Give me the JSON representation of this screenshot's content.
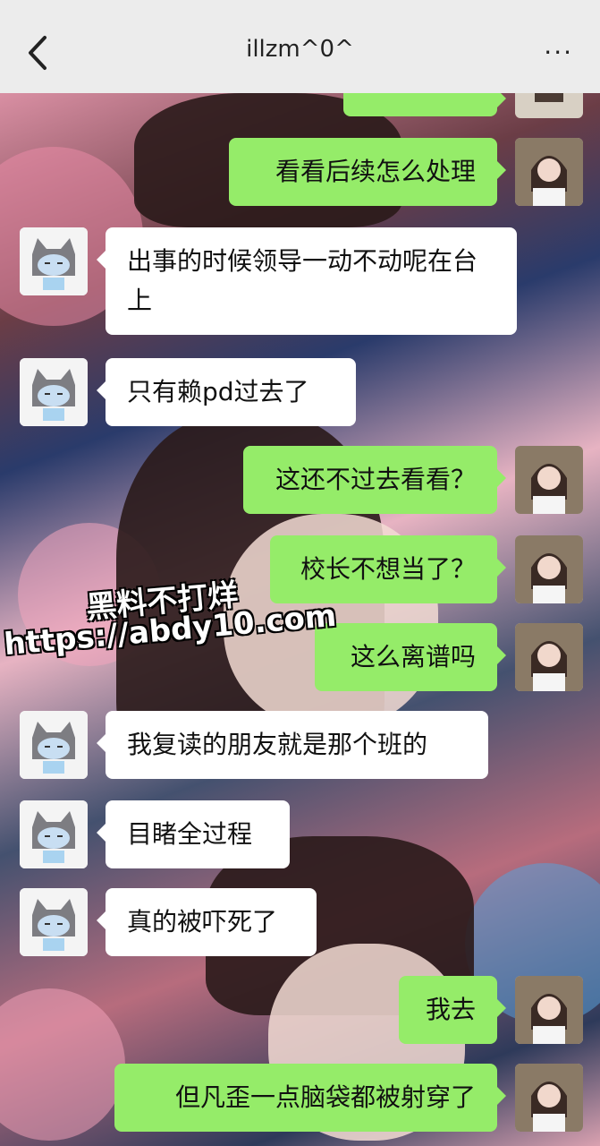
{
  "header": {
    "title": "illzm^0^",
    "more_label": "···"
  },
  "messages": [
    {
      "side": "out",
      "text": "看看后续怎么处理"
    },
    {
      "side": "in",
      "text": "出事的时候领导一动不动呢在台上"
    },
    {
      "side": "in",
      "text": "只有赖pd过去了"
    },
    {
      "side": "out",
      "text": "这还不过去看看？"
    },
    {
      "side": "out",
      "text": "校长不想当了？"
    },
    {
      "side": "out",
      "text": "这么离谱吗"
    },
    {
      "side": "in",
      "text": "我复读的朋友就是那个班的"
    },
    {
      "side": "in",
      "text": "目睹全过程"
    },
    {
      "side": "in",
      "text": "真的被吓死了"
    },
    {
      "side": "out",
      "text": "我去"
    },
    {
      "side": "out",
      "text": "但凡歪一点脑袋都被射穿了"
    }
  ],
  "watermark": {
    "line1": "黑料不打烊",
    "line2": "https://abdy10.com"
  }
}
